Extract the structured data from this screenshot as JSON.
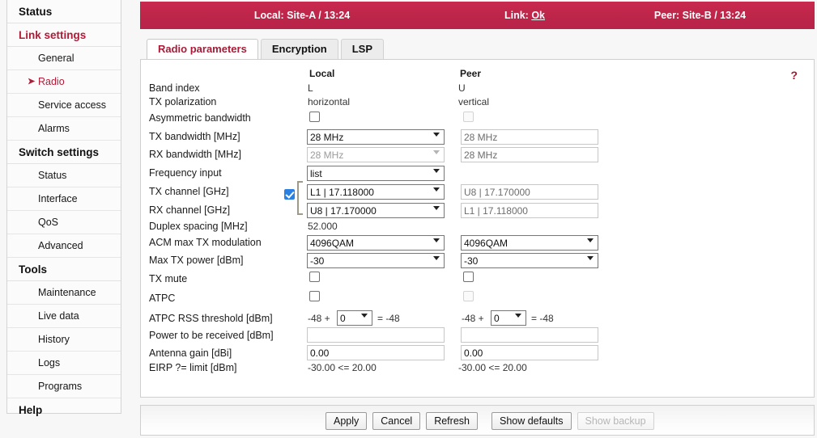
{
  "statusbar": {
    "local": "Local: Site-A / 13:24",
    "link_label": "Link: ",
    "link_value": "Ok",
    "peer": "Peer: Site-B / 13:24"
  },
  "sidebar": {
    "groups": [
      {
        "label": "Status",
        "accent": false
      },
      {
        "label": "Link settings",
        "accent": true
      },
      {
        "label": "Switch settings",
        "accent": false
      },
      {
        "label": "Tools",
        "accent": false
      },
      {
        "label": "Help",
        "accent": false
      }
    ],
    "link_items": [
      {
        "label": "General",
        "active": false
      },
      {
        "label": "Radio",
        "active": true
      },
      {
        "label": "Service access",
        "active": false
      },
      {
        "label": "Alarms",
        "active": false
      }
    ],
    "switch_items": [
      {
        "label": "Status"
      },
      {
        "label": "Interface"
      },
      {
        "label": "QoS"
      },
      {
        "label": "Advanced"
      }
    ],
    "tools_items": [
      {
        "label": "Maintenance"
      },
      {
        "label": "Live data"
      },
      {
        "label": "History"
      },
      {
        "label": "Logs"
      },
      {
        "label": "Programs"
      }
    ],
    "arrow_glyph": "➤"
  },
  "tabs": [
    {
      "label": "Radio parameters",
      "active": true
    },
    {
      "label": "Encryption",
      "active": false
    },
    {
      "label": "LSP",
      "active": false
    }
  ],
  "panel": {
    "help_glyph": "?",
    "column_headers": {
      "local": "Local",
      "peer": "Peer"
    },
    "rows": {
      "band_index": {
        "label": "Band index",
        "local": "L",
        "peer": "U"
      },
      "tx_polarization": {
        "label": "TX polarization",
        "local": "horizontal",
        "peer": "vertical"
      },
      "asymmetric_bw": {
        "label": "Asymmetric bandwidth"
      },
      "tx_bandwidth": {
        "label": "TX bandwidth [MHz]",
        "local": "28 MHz",
        "peer": "28 MHz"
      },
      "rx_bandwidth": {
        "label": "RX bandwidth [MHz]",
        "local": "28 MHz",
        "peer": "28 MHz"
      },
      "frequency_input": {
        "label": "Frequency input",
        "local": "list"
      },
      "tx_channel": {
        "label": "TX channel [GHz]",
        "local": "L1 | 17.118000",
        "peer": "U8 | 17.170000"
      },
      "rx_channel": {
        "label": "RX channel [GHz]",
        "local": "U8 | 17.170000",
        "peer": "L1 | 17.118000"
      },
      "duplex_spacing": {
        "label": "Duplex spacing [MHz]",
        "local": "52.000"
      },
      "acm_max_tx_mod": {
        "label": "ACM max TX modulation",
        "local": "4096QAM",
        "peer": "4096QAM"
      },
      "max_tx_power": {
        "label": "Max TX power [dBm]",
        "local": "-30",
        "peer": "-30"
      },
      "tx_mute": {
        "label": "TX mute"
      },
      "atpc": {
        "label": "ATPC"
      },
      "atpc_rss": {
        "label": "ATPC RSS threshold [dBm]",
        "base": "-48 +",
        "offset": "0",
        "eq": "= -48"
      },
      "power_received": {
        "label": "Power to be received [dBm]",
        "local": "",
        "peer": ""
      },
      "antenna_gain": {
        "label": "Antenna gain [dBi]",
        "local": "0.00",
        "peer": "0.00"
      },
      "eirp_limit": {
        "label": "EIRP ?= limit [dBm]",
        "local": "-30.00 <= 20.00",
        "peer": "-30.00 <= 20.00"
      }
    }
  },
  "footer": {
    "buttons": [
      {
        "label": "Apply",
        "disabled": false
      },
      {
        "label": "Cancel",
        "disabled": false
      },
      {
        "label": "Refresh",
        "disabled": false
      },
      {
        "label": "Show defaults",
        "disabled": false
      },
      {
        "label": "Show backup",
        "disabled": true
      }
    ]
  },
  "colors": {
    "accent": "#b01b38",
    "statusbar": "#bd2549",
    "checkbox_on": "#2a7fe0"
  }
}
